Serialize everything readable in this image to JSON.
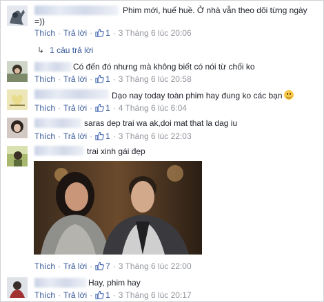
{
  "labels": {
    "like": "Thích",
    "reply": "Trả lời",
    "separator": "·"
  },
  "comments": [
    {
      "text": "Phim mới, huế huề. Ở nhà vẫn theo dõi từng ngày",
      "text2": "=))",
      "likes": "1",
      "date": "3 Tháng 6 lúc 20:06",
      "replies": "1 câu trả lời"
    },
    {
      "text": "Có đến đó nhưng mà không biết có nói từ chối ko",
      "likes": "1",
      "date": "3 Tháng 6 lúc 20:58"
    },
    {
      "text": "Dạo nay today toàn phim hay đung ko các bạn",
      "likes": "1",
      "date": "4 Tháng 6 lúc 6:04"
    },
    {
      "text": "saras dep trai wa ak,doi mat that la dag iu",
      "likes": "1",
      "date": "3 Tháng 6 lúc 22:03"
    },
    {
      "text": "trai xinh gái đẹp",
      "likes": "7",
      "date": "3 Tháng 6 lúc 22:00"
    },
    {
      "text": "Hay, phim hay",
      "likes": "1",
      "date": "3 Tháng 6 lúc 20:17"
    }
  ],
  "colors": {
    "link": "#365899",
    "meta": "#90949c",
    "like_icon": "#4267b2"
  }
}
